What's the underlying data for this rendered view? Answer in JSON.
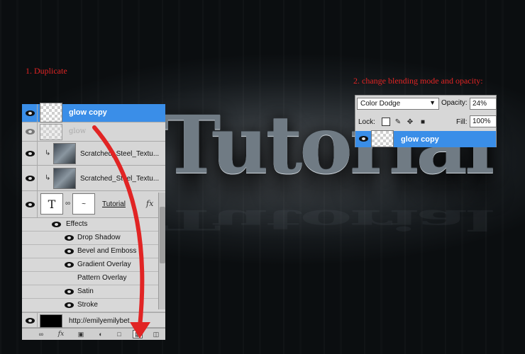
{
  "canvas": {
    "title_text": "Tutorial"
  },
  "captions": {
    "step1": "1. Duplicate",
    "step2": "2. change blending mode and opacity:"
  },
  "layers_panel": {
    "layers": [
      {
        "name": "glow copy",
        "selected": true,
        "thumb": "transparent-checker"
      },
      {
        "name": "glow",
        "hidden": true,
        "thumb": "transparent-checker"
      },
      {
        "name": "Scratched_Steel_Textu...",
        "clipped": true,
        "thumb": "steel-texture"
      },
      {
        "name": "Scratched_Steel_Textu...",
        "clipped": true,
        "thumb": "steel-texture"
      },
      {
        "name": "Tutorial",
        "type": "text",
        "has_fx": true,
        "thumb": "text-layer"
      }
    ],
    "effects_label": "Effects",
    "effects": [
      "Drop Shadow",
      "Bevel and Emboss",
      "Gradient Overlay",
      "Pattern Overlay",
      "Satin",
      "Stroke"
    ],
    "effects_visible": [
      true,
      true,
      true,
      false,
      true,
      true
    ],
    "background_layer": "http://emilyemilybet",
    "fx_badge": "fx",
    "text_thumb": "T",
    "bottom_icons": [
      "link-icon",
      "fx-icon",
      "mask-icon",
      "adjustment-icon",
      "folder-icon",
      "new-layer-icon",
      "trash-icon"
    ],
    "bottom_fx": "fx"
  },
  "blending_panel": {
    "mode": "Color Dodge",
    "opacity_label": "Opacity:",
    "opacity": "24%",
    "lock_label": "Lock:",
    "fill_label": "Fill:",
    "fill": "100%",
    "layer_name": "glow copy"
  },
  "colors": {
    "selection": "#3a8ee8",
    "annotation": "#e12424"
  }
}
